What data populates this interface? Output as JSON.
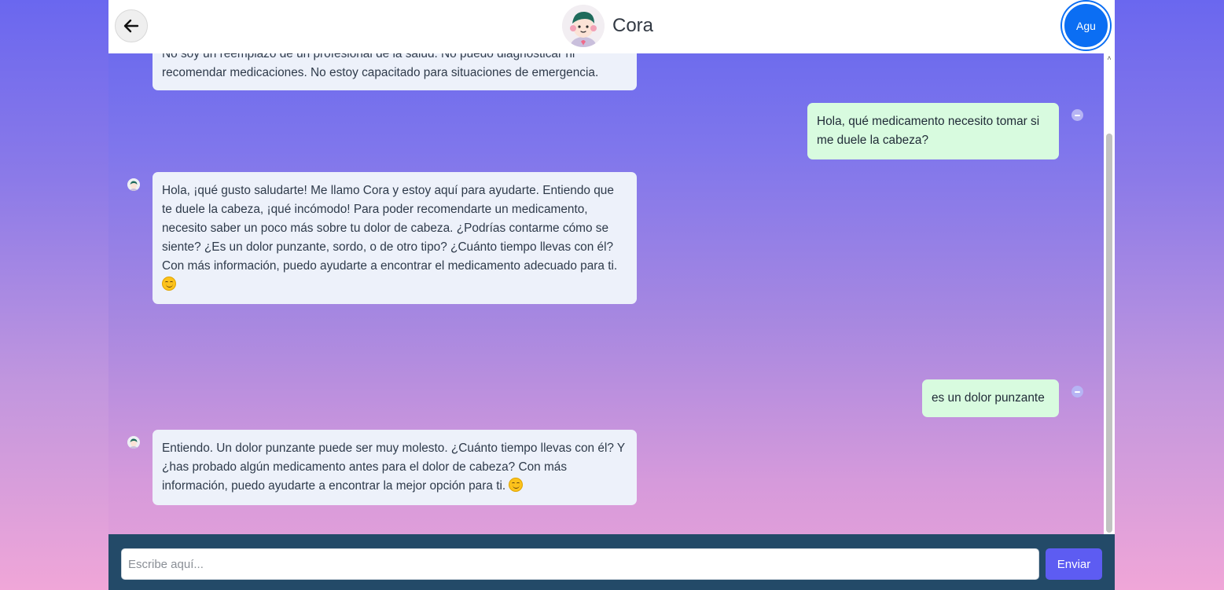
{
  "header": {
    "title": "Cora",
    "user_initials": "Agu",
    "back_icon": "arrow-left-icon"
  },
  "messages": [
    {
      "sender": "bot",
      "text": "No soy un reemplazo de un profesional de la salud. No puedo diagnosticar ni recomendar medicaciones. No estoy capacitado para situaciones de emergencia."
    },
    {
      "sender": "user",
      "text": "Hola, qué medicamento necesito tomar si me duele la cabeza?"
    },
    {
      "sender": "bot",
      "text": "Hola, ¡qué gusto saludarte! Me llamo Cora y estoy aquí para ayudarte. Entiendo que te duele la cabeza, ¡qué incómodo! Para poder recomendarte un medicamento, necesito saber un poco más sobre tu dolor de cabeza. ¿Podrías contarme cómo se siente? ¿Es un dolor punzante, sordo, o de otro tipo? ¿Cuánto tiempo llevas con él? Con más información, puedo ayudarte a encontrar el medicamento adecuado para ti.",
      "emoji": "smiling-face-icon"
    },
    {
      "sender": "user",
      "text": "es un dolor punzante"
    },
    {
      "sender": "bot",
      "text": "Entiendo. Un dolor punzante puede ser muy molesto. ¿Cuánto tiempo llevas con él? Y ¿has probado algún medicamento antes para el dolor de cabeza? Con más información, puedo ayudarte a encontrar la mejor opción para ti.",
      "emoji": "smiling-face-icon"
    }
  ],
  "composer": {
    "placeholder": "Escribe aquí...",
    "value": "",
    "send_label": "Enviar"
  },
  "colors": {
    "header_bg": "#ffffff",
    "bot_bubble": "#edf1fa",
    "user_bubble": "#d8fbdf",
    "input_bar": "#234a68",
    "send_button": "#5d5cf2",
    "user_avatar": "#0b6ef3"
  }
}
